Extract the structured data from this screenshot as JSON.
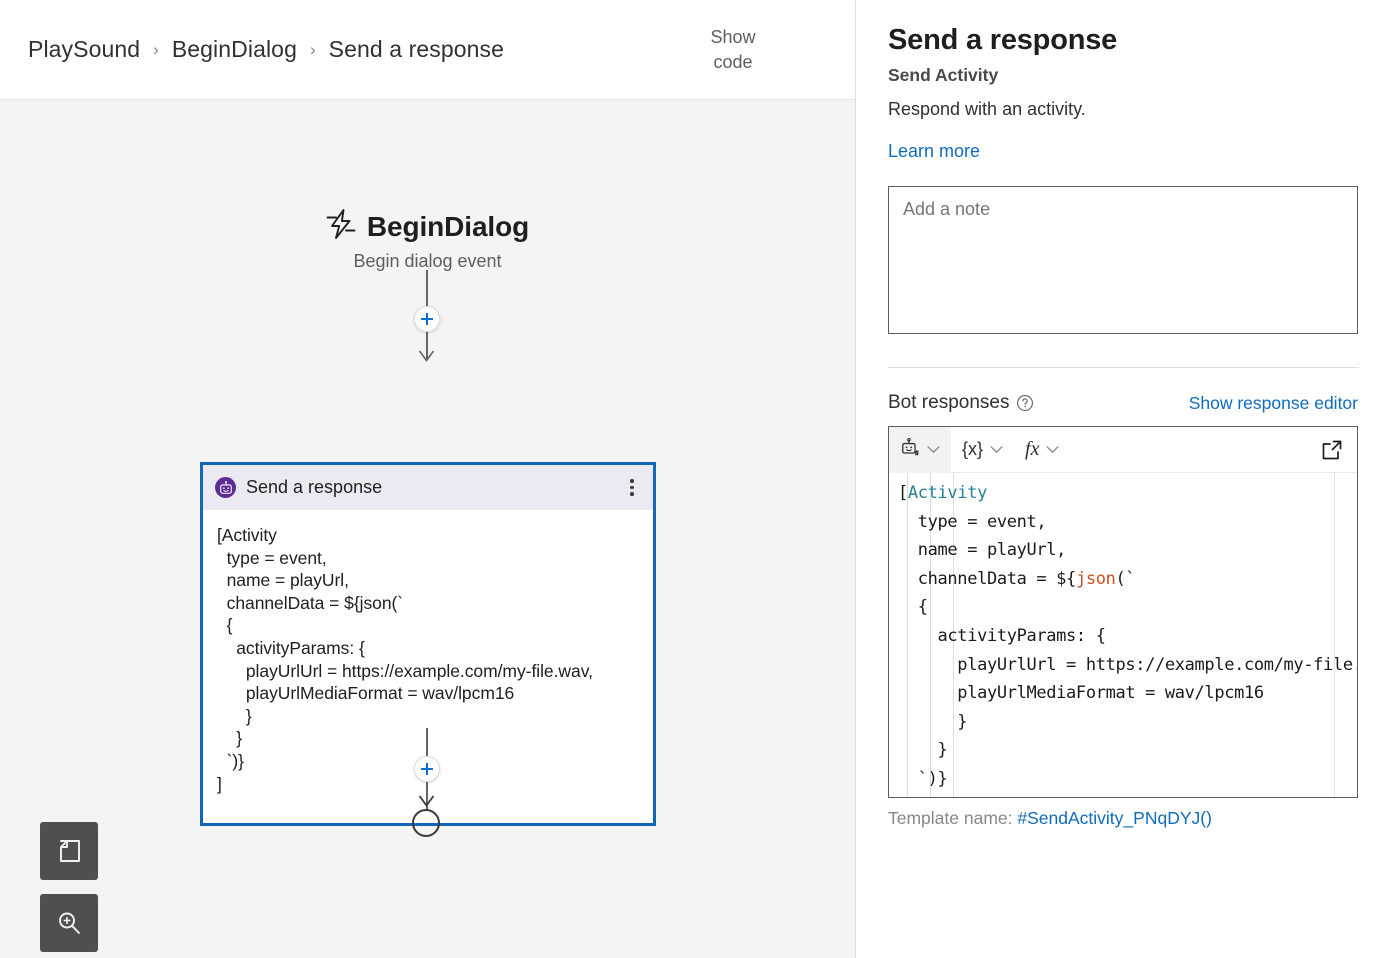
{
  "breadcrumb": {
    "items": [
      "PlaySound",
      "BeginDialog",
      "Send a response"
    ],
    "separator": "›"
  },
  "toolbar": {
    "show_code_label": "Show\ncode"
  },
  "canvas": {
    "trigger": {
      "name": "BeginDialog",
      "subtitle": "Begin dialog event",
      "icon": "lightning-bolt-icon"
    },
    "node": {
      "title": "Send a response",
      "icon": "bot-icon",
      "menu_icon": "more-vertical-icon",
      "body": "[Activity\n  type = event,\n  name = playUrl,\n  channelData = ${json(`\n  {\n    activityParams: {\n      playUrlUrl = https://example.com/my-file.wav,\n      playUrlMediaFormat = wav/lpcm16\n      }\n    }\n  `)}\n]"
    },
    "add_buttons": [
      "add-node-above-icon",
      "add-node-below-icon"
    ],
    "end_node": "end-of-flow-node",
    "tools": [
      {
        "name": "fit-to-screen-button",
        "icon": "page-fit-icon"
      },
      {
        "name": "zoom-in-button",
        "icon": "magnifier-plus-icon"
      }
    ]
  },
  "panel": {
    "title": "Send a response",
    "subtitle": "Send Activity",
    "description": "Respond with an activity.",
    "learn_more_label": "Learn more",
    "note": {
      "value": "",
      "placeholder": "Add a note"
    },
    "responses": {
      "label": "Bot responses",
      "help_icon": "question-circle-icon",
      "show_editor_label": "Show response editor",
      "editor_toolbar": [
        {
          "name": "response-type-dropdown",
          "icon": "bot-icon",
          "label": "",
          "chevron": "chevron-down-icon",
          "active": true
        },
        {
          "name": "variable-insert-dropdown",
          "icon": "",
          "label": "{x}",
          "chevron": "chevron-down-icon",
          "active": false
        },
        {
          "name": "function-insert-dropdown",
          "icon": "",
          "label": "fx",
          "chevron": "chevron-down-icon",
          "active": false
        }
      ],
      "popout_icon": "open-in-new-window-icon",
      "code_lines": [
        [
          {
            "t": "[",
            "c": "plain"
          },
          {
            "t": "Activity",
            "c": "tag"
          }
        ],
        [
          {
            "t": "  type = event,",
            "c": "plain"
          }
        ],
        [
          {
            "t": "  name = playUrl,",
            "c": "plain"
          }
        ],
        [
          {
            "t": "  channelData = ${",
            "c": "plain"
          },
          {
            "t": "json",
            "c": "fn"
          },
          {
            "t": "(`",
            "c": "plain"
          }
        ],
        [
          {
            "t": "  {",
            "c": "plain"
          }
        ],
        [
          {
            "t": "    activityParams: {",
            "c": "plain"
          }
        ],
        [
          {
            "t": "      playUrlUrl = https://example.com/my-file.wav,",
            "c": "plain"
          }
        ],
        [
          {
            "t": "      playUrlMediaFormat = wav/lpcm16",
            "c": "plain"
          }
        ],
        [
          {
            "t": "      }",
            "c": "plain"
          }
        ],
        [
          {
            "t": "    }",
            "c": "plain"
          }
        ],
        [
          {
            "t": "  `)}",
            "c": "plain"
          }
        ],
        [
          {
            "t": "]",
            "c": "plain"
          }
        ]
      ],
      "template_name_label": "Template name:",
      "template_name_value": "#SendActivity_PNqDYJ()"
    }
  },
  "colors": {
    "accent": "#0f6cbd",
    "selection_border": "#1267b8",
    "node_header": "#ebeaf3",
    "bot_purple": "#5c2e91",
    "canvas_bg": "#f4f4f4",
    "code_tag": "#267f99",
    "code_function": "#c74f20"
  }
}
